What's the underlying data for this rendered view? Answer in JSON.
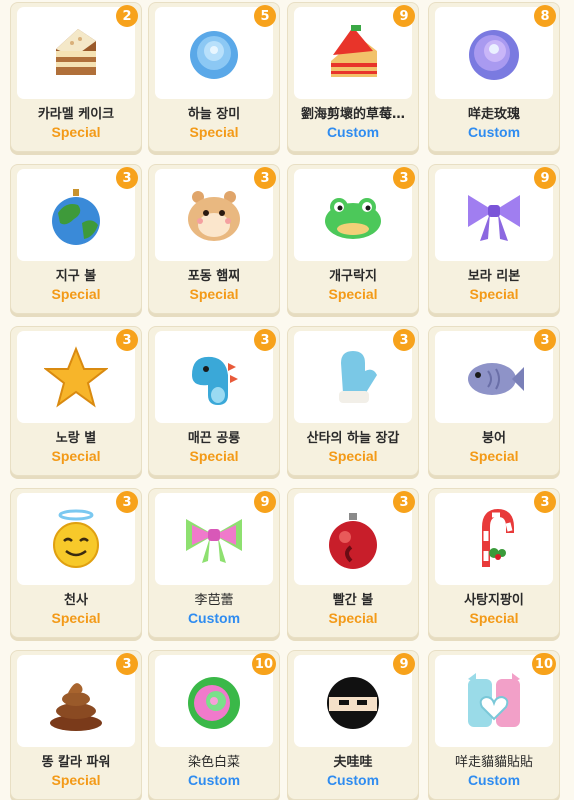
{
  "colors": {
    "special": "#f39a18",
    "custom": "#2f8cf0",
    "badge": "#f7a21b"
  },
  "items": [
    {
      "name": "카라멜 케이크",
      "type": "Special",
      "count": "2",
      "icon": "caramel-cake-icon"
    },
    {
      "name": "하늘 장미",
      "type": "Special",
      "count": "5",
      "icon": "sky-rose-icon"
    },
    {
      "name": "劉海剪壞的草莓…",
      "type": "Custom",
      "count": "9",
      "icon": "strawberry-cake-icon"
    },
    {
      "name": "咩走玫瑰",
      "type": "Custom",
      "count": "8",
      "icon": "purple-rose-icon"
    },
    {
      "name": "지구 볼",
      "type": "Special",
      "count": "3",
      "icon": "earth-ornament-icon"
    },
    {
      "name": "포동 햄찌",
      "type": "Special",
      "count": "3",
      "icon": "hamster-icon"
    },
    {
      "name": "개구락지",
      "type": "Special",
      "count": "3",
      "icon": "frog-icon"
    },
    {
      "name": "보라 리본",
      "type": "Special",
      "count": "9",
      "icon": "purple-ribbon-icon"
    },
    {
      "name": "노랑 별",
      "type": "Special",
      "count": "3",
      "icon": "yellow-star-icon"
    },
    {
      "name": "매끈 공룡",
      "type": "Special",
      "count": "3",
      "icon": "dinosaur-icon"
    },
    {
      "name": "산타의 하늘 장갑",
      "type": "Special",
      "count": "3",
      "icon": "mitten-icon"
    },
    {
      "name": "붕어",
      "type": "Special",
      "count": "3",
      "icon": "fish-bread-icon"
    },
    {
      "name": "천사",
      "type": "Special",
      "count": "3",
      "icon": "angel-emoji-icon"
    },
    {
      "name": "李芭蕾",
      "type": "Custom",
      "count": "9",
      "icon": "pink-ribbon-icon"
    },
    {
      "name": "빨간 볼",
      "type": "Special",
      "count": "3",
      "icon": "red-ornament-icon"
    },
    {
      "name": "사탕지팡이",
      "type": "Special",
      "count": "3",
      "icon": "candy-cane-icon"
    },
    {
      "name": "똥 칼라 파워",
      "type": "Special",
      "count": "3",
      "icon": "poop-icon"
    },
    {
      "name": "染色白菜",
      "type": "Custom",
      "count": "10",
      "icon": "cabbage-icon"
    },
    {
      "name": "夫哇哇",
      "type": "Custom",
      "count": "9",
      "icon": "ninja-icon"
    },
    {
      "name": "咩走貓貓貼貼",
      "type": "Custom",
      "count": "10",
      "icon": "cats-heart-icon"
    }
  ]
}
